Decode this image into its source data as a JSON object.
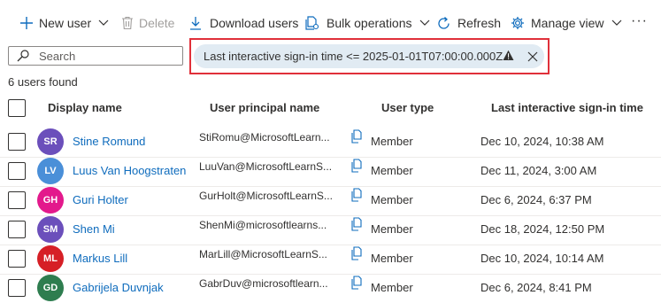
{
  "toolbar": {
    "new_user": "New user",
    "delete": "Delete",
    "download_users": "Download users",
    "bulk_operations": "Bulk operations",
    "refresh": "Refresh",
    "manage_view": "Manage view",
    "more": "···"
  },
  "search": {
    "placeholder": "Search"
  },
  "filter": {
    "text": "Last interactive sign-in time <= 2025-01-01T07:00:00.000Z"
  },
  "results": {
    "count_text": "6 users found"
  },
  "table": {
    "headers": {
      "display_name": "Display name",
      "upn": "User principal name",
      "user_type": "User type",
      "last_signin": "Last interactive sign-in time"
    },
    "rows": [
      {
        "initials": "SR",
        "avatar_color": "#6b4fbb",
        "display_name": "Stine Romund",
        "upn": "StiRomu@MicrosoftLearn...",
        "user_type": "Member",
        "last_signin": "Dec 10, 2024, 10:38 AM"
      },
      {
        "initials": "LV",
        "avatar_color": "#4a8fd8",
        "display_name": "Luus Van Hoogstraten",
        "upn": "LuuVan@MicrosoftLearnS...",
        "user_type": "Member",
        "last_signin": "Dec 11, 2024, 3:00 AM"
      },
      {
        "initials": "GH",
        "avatar_color": "#e3198c",
        "display_name": "Guri Holter",
        "upn": "GurHolt@MicrosoftLearnS...",
        "user_type": "Member",
        "last_signin": "Dec 6, 2024, 6:37 PM"
      },
      {
        "initials": "SM",
        "avatar_color": "#6b4fbb",
        "display_name": "Shen Mi",
        "upn": "ShenMi@microsoftlearns...",
        "user_type": "Member",
        "last_signin": "Dec 18, 2024, 12:50 PM"
      },
      {
        "initials": "ML",
        "avatar_color": "#d61f26",
        "display_name": "Markus Lill",
        "upn": "MarLill@MicrosoftLearnS...",
        "user_type": "Member",
        "last_signin": "Dec 10, 2024, 10:14 AM"
      },
      {
        "initials": "GD",
        "avatar_color": "#2e7d4f",
        "display_name": "Gabrijela Duvnjak",
        "upn": "GabrDuv@microsoftlearn...",
        "user_type": "Member",
        "last_signin": "Dec 6, 2024, 8:41 PM"
      }
    ]
  },
  "icons": {
    "toolbar": [
      "plus-icon",
      "chevron-down-icon",
      "trash-icon",
      "download-icon",
      "bulk-operations-icon",
      "refresh-icon",
      "gear-icon",
      "more-icon"
    ],
    "filter": [
      "search-icon",
      "warning-icon",
      "close-icon"
    ],
    "row": [
      "copy-icon"
    ]
  },
  "colors": {
    "link": "#0f6cbd",
    "filter_pill": "#e1ebf3",
    "highlight": "#e0303a",
    "accent": "#0f6cbd"
  }
}
